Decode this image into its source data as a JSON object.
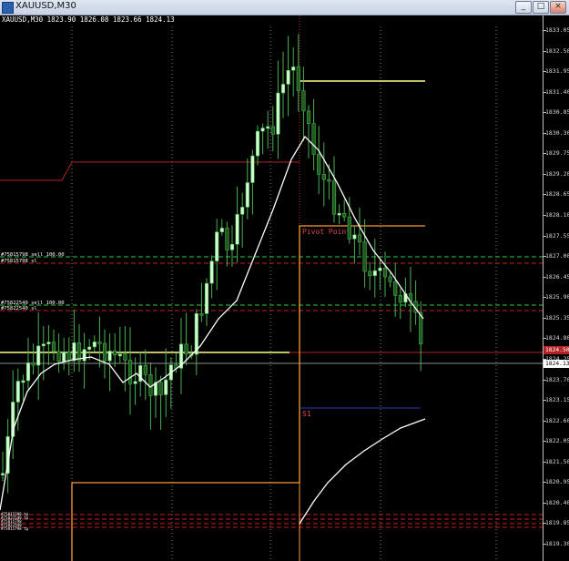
{
  "window": {
    "title": "XAUUSD,M30",
    "minimize_glyph": "_",
    "maximize_glyph": "□",
    "close_glyph": "×"
  },
  "chart": {
    "symbol_line": "XAUUSD,M30  1823.90 1826.08 1823.66 1824.13",
    "price_axis": [
      "1833.05",
      "1832.50",
      "1831.95",
      "1831.40",
      "1830.85",
      "1830.30",
      "1829.75",
      "1829.20",
      "1828.65",
      "1828.10",
      "1827.55",
      "1827.00",
      "1826.45",
      "1825.90",
      "1825.35",
      "1824.80",
      "1824.25",
      "1823.70",
      "1823.15",
      "1822.60",
      "1822.05",
      "1821.50",
      "1820.95",
      "1820.40",
      "1819.85",
      "1819.30"
    ],
    "current_price": "1824.13",
    "red_price": "1824.50",
    "order_labels": {
      "order1": "#75815798 sell 100.00",
      "order1_sl": "#75815798 sl",
      "order2": "#75822540 sell 100.00",
      "order2_sl": "#75822540 sl"
    },
    "pivot_label": "Pivot Point",
    "s1_label": "S1",
    "bottom_labels": [
      "#75815798 tp",
      "#75822540 tp",
      "#75815798",
      "#75822540",
      "#75815798 tp"
    ],
    "colors": {
      "background": "#000000",
      "bull_candle": "#ccffcc",
      "bear_candle": "#1e5c1e",
      "wick": "#4caf50",
      "ma_line": "#ffffff",
      "pivot": "#ff9933",
      "resistance": "#ffff88",
      "support": "#1a2f9e",
      "red_level": "#b22222",
      "order_line": "#33cc33",
      "sl_line": "#cc2222"
    }
  }
}
